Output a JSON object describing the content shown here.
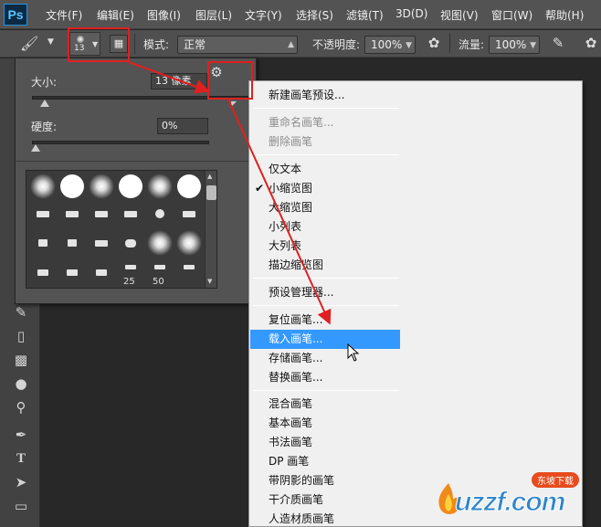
{
  "app": {
    "logo": "Ps"
  },
  "menubar": [
    "文件(F)",
    "编辑(E)",
    "图像(I)",
    "图层(L)",
    "文字(Y)",
    "选择(S)",
    "滤镜(T)",
    "3D(D)",
    "视图(V)",
    "窗口(W)",
    "帮助(H)"
  ],
  "options": {
    "brush_size": "13",
    "mode_label": "模式:",
    "mode_value": "正常",
    "opacity_label": "不透明度:",
    "opacity_value": "100%",
    "flow_label": "流量:",
    "flow_value": "100%"
  },
  "brush_panel": {
    "size_label": "大小:",
    "size_value": "13 像素",
    "hardness_label": "硬度:",
    "hardness_value": "0%",
    "size_slider_fraction": 0.06,
    "hardness_slider_fraction": 0.02,
    "preset_numbers": [
      "25",
      "50"
    ]
  },
  "context_menu": {
    "items": [
      {
        "label": "新建画笔预设...",
        "disabled": false
      },
      {
        "label": "重命名画笔...",
        "disabled": true
      },
      {
        "label": "删除画笔",
        "disabled": true
      },
      {
        "label": "仅文本",
        "disabled": false
      },
      {
        "label": "小缩览图",
        "disabled": false,
        "checked": true
      },
      {
        "label": "大缩览图",
        "disabled": false
      },
      {
        "label": "小列表",
        "disabled": false
      },
      {
        "label": "大列表",
        "disabled": false
      },
      {
        "label": "描边缩览图",
        "disabled": false
      },
      {
        "label": "预设管理器...",
        "disabled": false
      },
      {
        "label": "复位画笔...",
        "disabled": false
      },
      {
        "label": "载入画笔...",
        "disabled": false,
        "highlighted": true
      },
      {
        "label": "存储画笔...",
        "disabled": false
      },
      {
        "label": "替换画笔...",
        "disabled": false
      },
      {
        "label": "混合画笔",
        "disabled": false
      },
      {
        "label": "基本画笔",
        "disabled": false
      },
      {
        "label": "书法画笔",
        "disabled": false
      },
      {
        "label": "DP 画笔",
        "disabled": false
      },
      {
        "label": "带阴影的画笔",
        "disabled": false
      },
      {
        "label": "干介质画笔",
        "disabled": false
      },
      {
        "label": "人造材质画笔",
        "disabled": false
      }
    ]
  },
  "watermark": {
    "text": "uzzf.com",
    "badge": "东坡下载"
  },
  "colors": {
    "annotation": "#e02020",
    "highlight": "#3399ff"
  }
}
